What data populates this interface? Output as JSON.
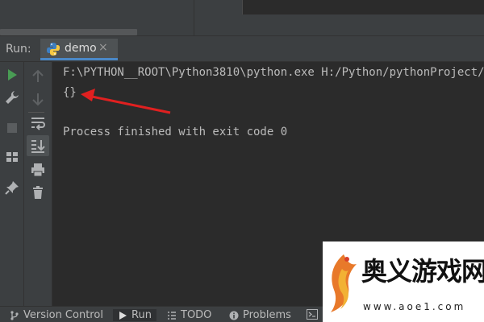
{
  "run_panel": {
    "label": "Run:",
    "tab": {
      "label": "demo",
      "close": "×",
      "icon": "python-icon"
    }
  },
  "console": {
    "lines": [
      "F:\\PYTHON__ROOT\\Python3810\\python.exe H:/Python/pythonProject/",
      "{}",
      "",
      "Process finished with exit code 0"
    ],
    "annotation": {
      "type": "red-arrow",
      "color": "#e02020"
    }
  },
  "bottom_tabs": [
    {
      "label": "Version Control",
      "icon": "branch-icon"
    },
    {
      "label": "Run",
      "icon": "play-icon"
    },
    {
      "label": "TODO",
      "icon": "list-icon"
    },
    {
      "label": "Problems",
      "icon": "info-icon"
    }
  ],
  "watermark": {
    "title": "奥义游戏网",
    "url": "www.aoe1.com"
  },
  "colors": {
    "accent": "#4a88c7",
    "run_green": "#499c54",
    "background": "#2b2b2b",
    "panel": "#3c3f41"
  }
}
